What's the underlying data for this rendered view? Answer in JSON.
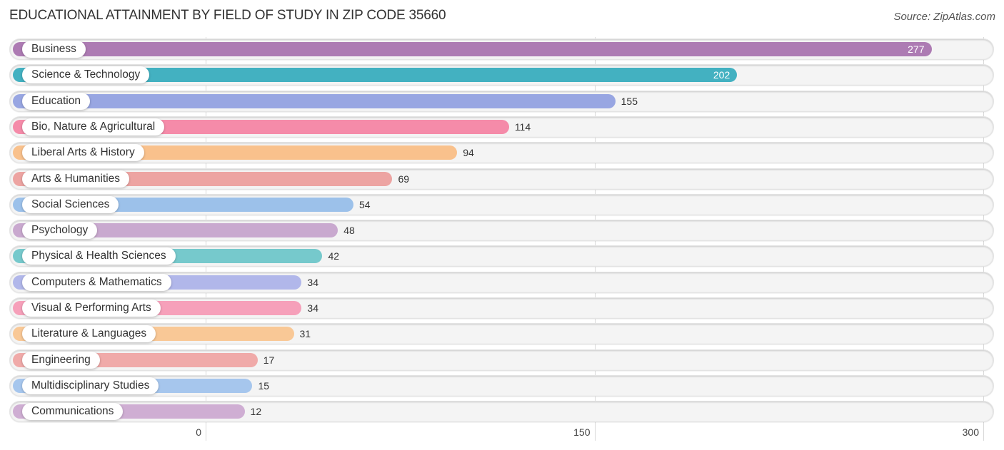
{
  "header": {
    "title": "EDUCATIONAL ATTAINMENT BY FIELD OF STUDY IN ZIP CODE 35660",
    "source": "Source: ZipAtlas.com"
  },
  "chart_data": {
    "type": "bar",
    "orientation": "horizontal",
    "title": "EDUCATIONAL ATTAINMENT BY FIELD OF STUDY IN ZIP CODE 35660",
    "xlabel": "",
    "ylabel": "",
    "xlim": [
      0,
      300
    ],
    "xticks": [
      0,
      150,
      300
    ],
    "xtick_labels": [
      "0",
      "150",
      "300"
    ],
    "grid": true,
    "categories": [
      "Business",
      "Science & Technology",
      "Education",
      "Bio, Nature & Agricultural",
      "Liberal Arts & History",
      "Arts & Humanities",
      "Social Sciences",
      "Psychology",
      "Physical & Health Sciences",
      "Computers & Mathematics",
      "Visual & Performing Arts",
      "Literature & Languages",
      "Engineering",
      "Multidisciplinary Studies",
      "Communications"
    ],
    "values": [
      277,
      202,
      155,
      114,
      94,
      69,
      54,
      48,
      42,
      34,
      34,
      31,
      17,
      15,
      12
    ],
    "colors": [
      "#ad7bb3",
      "#43b1c1",
      "#98a6e2",
      "#f58ba9",
      "#f9c18c",
      "#eda4a2",
      "#9cc1ea",
      "#c9a9cf",
      "#76c9cc",
      "#b1b7ea",
      "#f6a0ba",
      "#f9c896",
      "#f0aaa9",
      "#a6c6ed",
      "#cfaed3"
    ],
    "value_labels_inside": [
      true,
      true,
      false,
      false,
      false,
      false,
      false,
      false,
      false,
      false,
      false,
      false,
      false,
      false,
      false
    ]
  }
}
